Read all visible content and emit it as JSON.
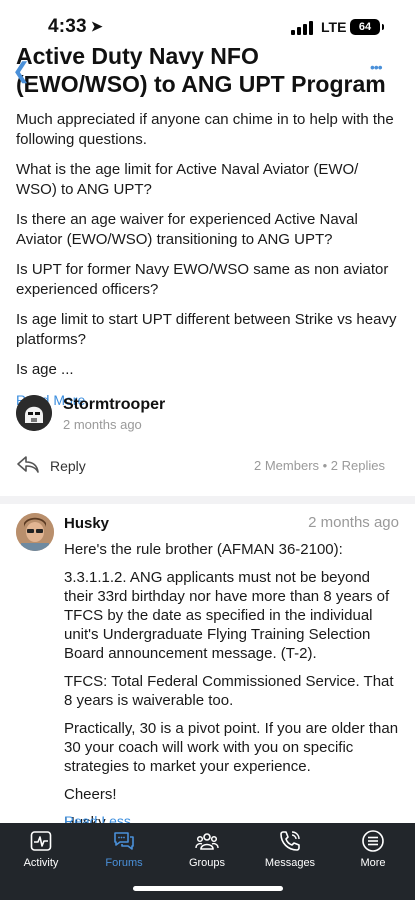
{
  "status_bar": {
    "time": "4:33",
    "network": "LTE",
    "battery": "64"
  },
  "thread": {
    "title": "Active Duty Navy NFO (EWO/WSO) to ANG UPT Program",
    "paragraphs": [
      "Much appreciated if anyone can chime in to help with the following questions.",
      "What is the age limit for Active Naval Aviator (EWO/ WSO) to ANG UPT?",
      "Is there an age waiver for experienced Active Naval Aviator (EWO/WSO) transitioning to ANG UPT?",
      "Is UPT for former Navy EWO/WSO same as non aviator experienced officers?",
      "Is age limit to start UPT different between Strike vs heavy platforms?",
      "Is age ..."
    ],
    "read_more": "Read More",
    "author": "Stormtrooper",
    "posted": "2 months ago",
    "reply_label": "Reply",
    "stats": "2 Members • 2 Replies"
  },
  "reply": {
    "author": "Husky",
    "posted": "2 months ago",
    "paragraphs": [
      "Here's the rule brother (AFMAN 36-2100):",
      "3.3.1.1.2. ANG applicants must not be beyond their 33rd birthday nor have more than 8 years of TFCS by the date as specified in the individual unit's Undergraduate Flying Training Selection Board announcement message. (T-2).",
      "TFCS: Total Federal Commissioned Service. That 8 years is waiverable too.",
      "Practically, 30 is a pivot point. If you are older than 30 your coach will work with you on specific strategies to market your experience.",
      "Cheers!",
      "Husky"
    ],
    "read_less": "Read Less"
  },
  "tabs": [
    {
      "label": "Activity",
      "icon": "activity-icon"
    },
    {
      "label": "Forums",
      "icon": "forums-icon",
      "active": true
    },
    {
      "label": "Groups",
      "icon": "groups-icon"
    },
    {
      "label": "Messages",
      "icon": "messages-icon"
    },
    {
      "label": "More",
      "icon": "more-icon"
    }
  ],
  "colors": {
    "accent": "#4a90d9",
    "tabbar": "#22262b",
    "muted": "#9a9a9a"
  }
}
